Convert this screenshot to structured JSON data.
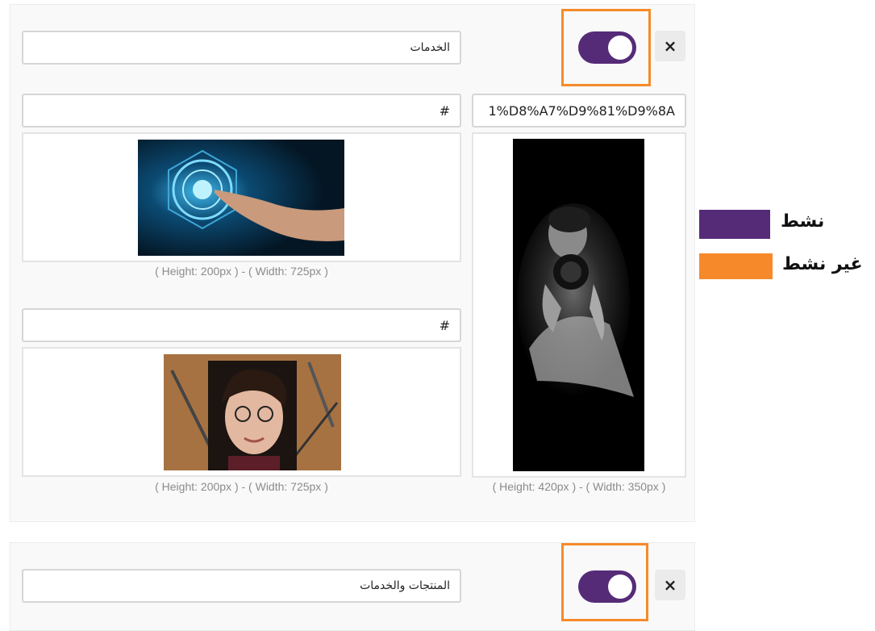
{
  "colors": {
    "active": "#552b78",
    "inactive": "#f68a2a"
  },
  "section1": {
    "close_label": "×",
    "toggle_state": "on",
    "title_value": "الخدمات",
    "link_main_value": "1%D8%A7%D9%81%D9%8A",
    "link_top_value": "#",
    "link_bottom_value": "#",
    "caption_main": "( Height: 420px ) - ( Width: 350px )",
    "caption_top": "( Height: 200px ) - ( Width: 725px )",
    "caption_bottom": "( Height: 200px ) - ( Width: 725px )",
    "images": {
      "main": "photographer-photo",
      "top": "digital-touch-photo",
      "bottom": "portrait-drawing-photo"
    }
  },
  "section2": {
    "close_label": "×",
    "toggle_state": "on",
    "title_value": "المنتجات والخدمات"
  },
  "legend": {
    "active_label": "نشط",
    "inactive_label": "غير نشط"
  }
}
